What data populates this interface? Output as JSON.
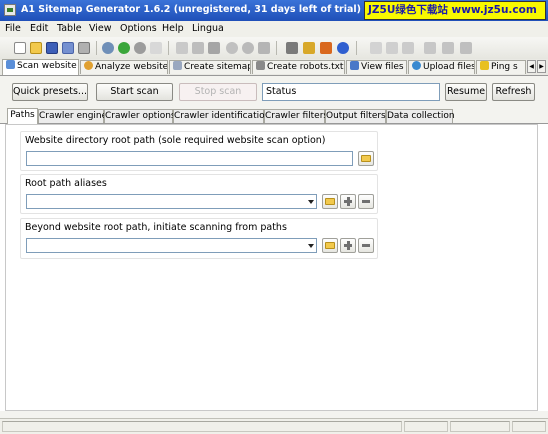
{
  "window": {
    "title": "A1 Sitemap Generator 1.6.2 (unregistered, 31 days left of trial) - new p",
    "watermark": "JZ5U绿色下载站 www.jz5u.com"
  },
  "menu": [
    "File",
    "Edit",
    "Table",
    "View",
    "Options",
    "Help",
    "Lingua"
  ],
  "toolbar_icons": [
    "new-file-icon",
    "open-folder-icon",
    "save-icon",
    "save-as-icon",
    "print-icon",
    "back-icon",
    "forward-icon",
    "refresh-icon",
    "text-icon",
    "cut-icon",
    "copy-icon",
    "paste-icon",
    "undo-icon",
    "search-icon",
    "replace-icon",
    "cart-icon",
    "key-icon",
    "home-icon",
    "help-icon",
    "align-left-icon",
    "align-tree-icon",
    "align-center-icon",
    "align-split-icon",
    "align-right-icon",
    "align-tree-right-icon"
  ],
  "main_tabs": [
    {
      "label": "Scan website",
      "icon": "scan-icon"
    },
    {
      "label": "Analyze website",
      "icon": "pie-icon"
    },
    {
      "label": "Create sitemap",
      "icon": "sitemap-icon"
    },
    {
      "label": "Create robots.txt",
      "icon": "filter-icon"
    },
    {
      "label": "View files",
      "icon": "view-icon"
    },
    {
      "label": "Upload files",
      "icon": "upload-icon"
    },
    {
      "label": "Ping s",
      "icon": "ping-icon"
    }
  ],
  "actions": {
    "quick_presets": "Quick presets...",
    "start_scan": "Start scan",
    "stop_scan": "Stop scan",
    "status": "Status",
    "resume": "Resume",
    "refresh": "Refresh"
  },
  "sub_tabs": [
    "Paths",
    "Crawler engine",
    "Crawler options",
    "Crawler identification",
    "Crawler filters",
    "Output filters",
    "Data collection"
  ],
  "groups": {
    "root_path": {
      "label": "Website directory root path (sole required website scan option)",
      "value": ""
    },
    "aliases": {
      "label": "Root path aliases",
      "value": ""
    },
    "beyond": {
      "label": "Beyond website root path, initiate scanning from paths",
      "value": ""
    }
  },
  "colors": {
    "titlebar": "#2a5fc8",
    "watermark_bg": "#f9f900",
    "watermark_text": "#1a1aaa",
    "field_border": "#7f9db9"
  }
}
